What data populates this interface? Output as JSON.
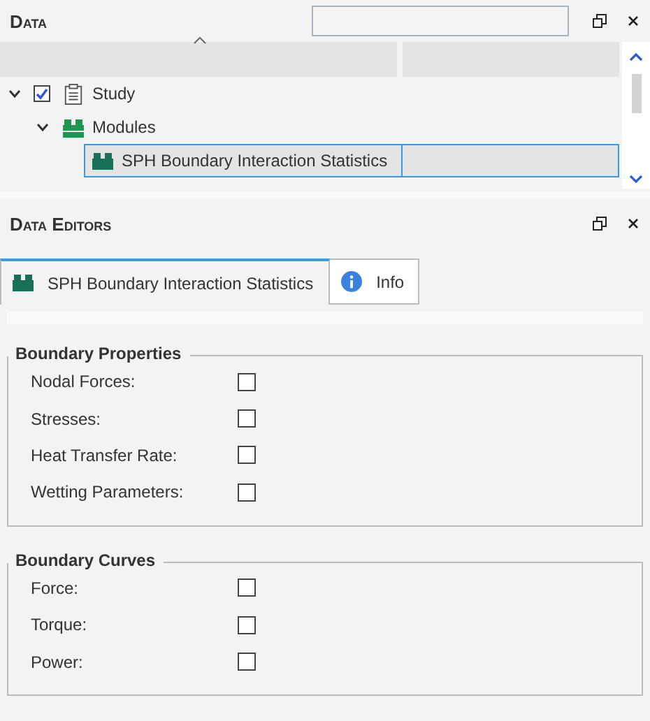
{
  "data_panel": {
    "title": "Data",
    "tree": [
      {
        "label": "Study",
        "kind": "study",
        "expanded": true,
        "checked": true,
        "selected": false,
        "children": [
          {
            "label": "Modules",
            "kind": "folder",
            "expanded": true,
            "selected": false,
            "children": [
              {
                "label": "SPH Boundary Interaction Statistics",
                "kind": "module",
                "selected": true
              }
            ]
          }
        ]
      }
    ]
  },
  "editors_panel": {
    "title": "Data Editors",
    "tabs": [
      {
        "label": "SPH Boundary Interaction Statistics",
        "kind": "module",
        "selected": true
      },
      {
        "label": "Info",
        "kind": "info",
        "selected": false
      }
    ],
    "groups": [
      {
        "title": "Boundary Properties",
        "options": [
          {
            "label": "Nodal Forces:",
            "checked": false
          },
          {
            "label": "Stresses:",
            "checked": false
          },
          {
            "label": "Heat Transfer Rate:",
            "checked": false
          },
          {
            "label": "Wetting Parameters:",
            "checked": false
          }
        ]
      },
      {
        "title": "Boundary Curves",
        "options": [
          {
            "label": "Force:",
            "checked": false
          },
          {
            "label": "Torque:",
            "checked": false
          },
          {
            "label": "Power:",
            "checked": false
          }
        ]
      }
    ]
  }
}
